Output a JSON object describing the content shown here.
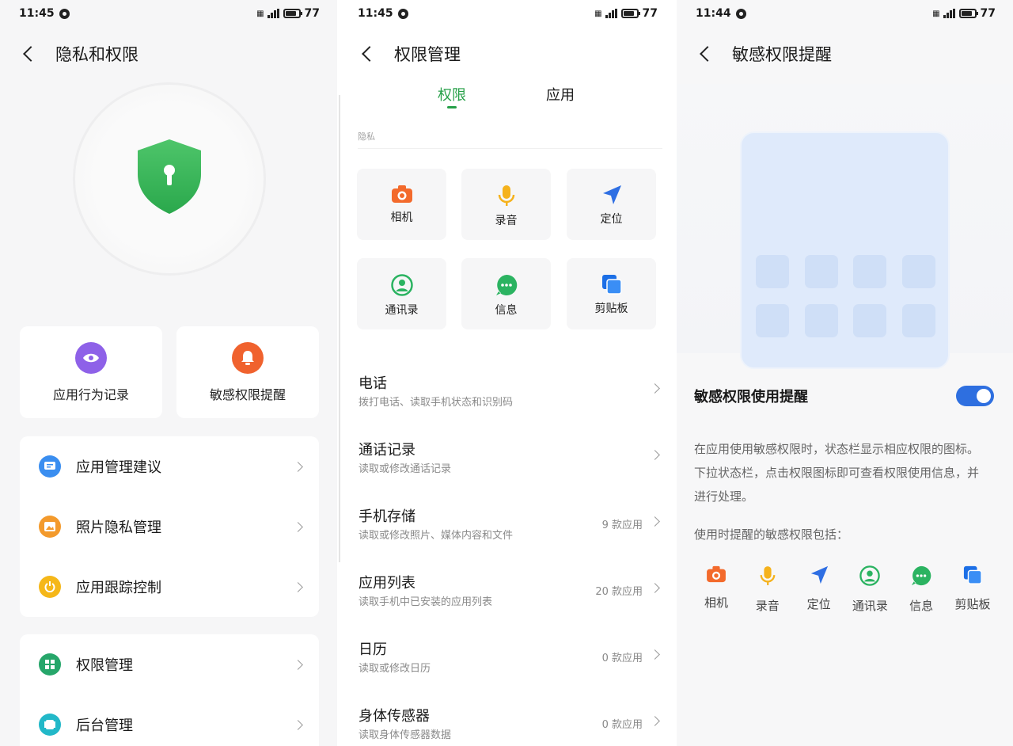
{
  "panel1": {
    "status": {
      "time": "11:45",
      "battery": "77"
    },
    "title": "隐私和权限",
    "quick": [
      {
        "label": "应用行为记录",
        "color": "#8e61e8"
      },
      {
        "label": "敏感权限提醒",
        "color": "#f0622e"
      }
    ],
    "group1": [
      {
        "label": "应用管理建议",
        "color": "#3a8ef0"
      },
      {
        "label": "照片隐私管理",
        "color": "#f39a2c"
      },
      {
        "label": "应用跟踪控制",
        "color": "#f5b719"
      }
    ],
    "group2": [
      {
        "label": "权限管理",
        "color": "#26a66a"
      },
      {
        "label": "后台管理",
        "color": "#22b8c8"
      }
    ]
  },
  "panel2": {
    "status": {
      "time": "11:45",
      "battery": "77"
    },
    "title": "权限管理",
    "tabs": [
      "权限",
      "应用"
    ],
    "section_label": "隐私",
    "tiles": [
      "相机",
      "录音",
      "定位",
      "通讯录",
      "信息",
      "剪贴板"
    ],
    "permissions": [
      {
        "title": "电话",
        "subtitle": "拨打电话、读取手机状态和识别码",
        "count": ""
      },
      {
        "title": "通话记录",
        "subtitle": "读取或修改通话记录",
        "count": ""
      },
      {
        "title": "手机存储",
        "subtitle": "读取或修改照片、媒体内容和文件",
        "count": "9 款应用"
      },
      {
        "title": "应用列表",
        "subtitle": "读取手机中已安装的应用列表",
        "count": "20 款应用"
      },
      {
        "title": "日历",
        "subtitle": "读取或修改日历",
        "count": "0 款应用"
      },
      {
        "title": "身体传感器",
        "subtitle": "读取身体传感器数据",
        "count": "0 款应用"
      }
    ]
  },
  "panel3": {
    "status": {
      "time": "11:44",
      "battery": "77"
    },
    "title": "敏感权限提醒",
    "toggle_label": "敏感权限使用提醒",
    "toggle_on": true,
    "description": "在应用使用敏感权限时，状态栏显示相应权限的图标。下拉状态栏，点击权限图标即可查看权限使用信息，并进行处理。",
    "includes_label": "使用时提醒的敏感权限包括：",
    "icons": [
      "相机",
      "录音",
      "定位",
      "通讯录",
      "信息",
      "剪贴板"
    ]
  }
}
